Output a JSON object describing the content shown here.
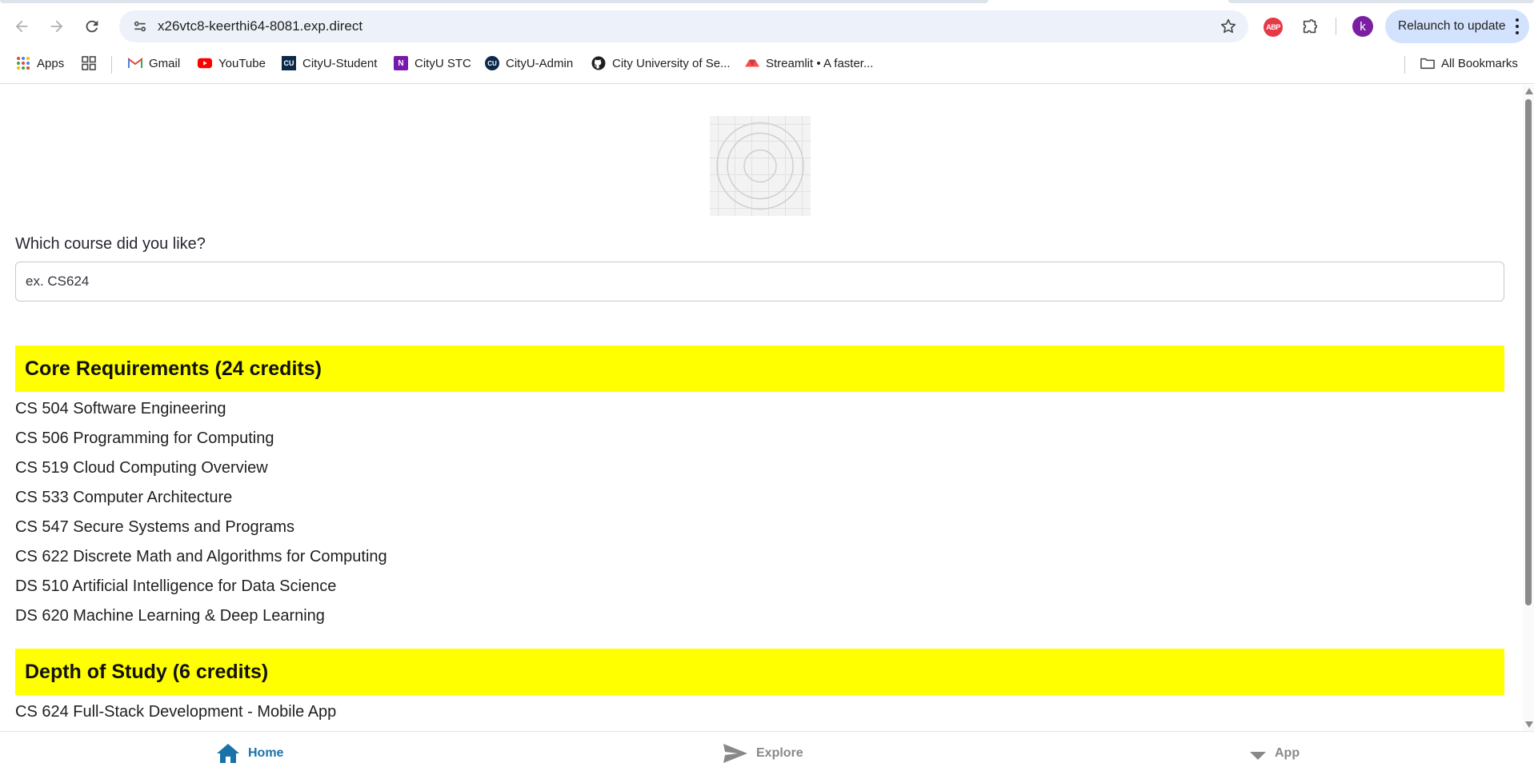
{
  "browser": {
    "url": "x26vtc8-keerthi64-8081.exp.direct",
    "avatar_letter": "k",
    "relaunch_label": "Relaunch to update",
    "extension_badge": "ABP"
  },
  "bookmarks": {
    "items": [
      {
        "label": "Apps",
        "icon": "apps-grid-icon"
      },
      {
        "label": "Gmail",
        "icon": "gmail-icon"
      },
      {
        "label": "YouTube",
        "icon": "youtube-icon"
      },
      {
        "label": "CityU-Student",
        "icon": "cityu-icon"
      },
      {
        "label": "CityU STC",
        "icon": "onenote-icon"
      },
      {
        "label": "CityU-Admin",
        "icon": "cityu-icon"
      },
      {
        "label": "City University of Se...",
        "icon": "github-icon"
      },
      {
        "label": "Streamlit • A faster...",
        "icon": "streamlit-icon"
      }
    ],
    "all_bookmarks": "All Bookmarks"
  },
  "main": {
    "question": "Which course did you like?",
    "input_placeholder": "ex. CS624",
    "sections": [
      {
        "title": "Core Requirements (24 credits)",
        "courses": [
          "CS 504 Software Engineering",
          "CS 506 Programming for Computing",
          "CS 519 Cloud Computing Overview",
          "CS 533 Computer Architecture",
          "CS 547 Secure Systems and Programs",
          "CS 622 Discrete Math and Algorithms for Computing",
          "DS 510 Artificial Intelligence for Data Science",
          "DS 620 Machine Learning & Deep Learning"
        ]
      },
      {
        "title": "Depth of Study (6 credits)",
        "courses": [
          "CS 624 Full-Stack Development - Mobile App"
        ]
      }
    ]
  },
  "bottom_nav": {
    "items": [
      {
        "label": "Home",
        "icon": "home-icon",
        "active": true
      },
      {
        "label": "Explore",
        "icon": "send-icon",
        "active": false
      },
      {
        "label": "App",
        "icon": "caret-down-icon",
        "active": false
      }
    ]
  },
  "colors": {
    "section_header_bg": "#ffff00",
    "active_nav": "#1a73a8",
    "inactive_nav": "#888888"
  }
}
